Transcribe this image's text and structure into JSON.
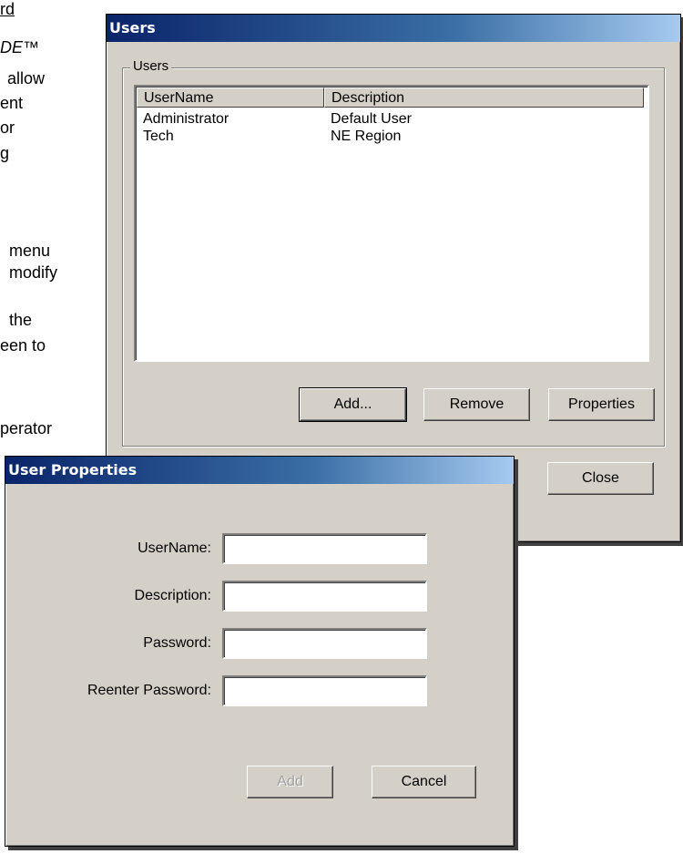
{
  "background_doc": {
    "lines": [
      "rd",
      "DE™",
      "allow",
      "ent",
      "or",
      "g",
      "menu",
      "modify",
      "the",
      "een to",
      "perator"
    ]
  },
  "users_window": {
    "title": "Users",
    "group_label": "Users",
    "columns": [
      "UserName",
      "Description"
    ],
    "rows": [
      {
        "username": "Administrator",
        "description": "Default User"
      },
      {
        "username": "Tech",
        "description": "NE Region"
      }
    ],
    "buttons": {
      "add": "Add...",
      "remove": "Remove",
      "properties": "Properties",
      "close": "Close"
    }
  },
  "user_properties_window": {
    "title": "User Properties",
    "fields": {
      "username": {
        "label": "UserName:",
        "value": ""
      },
      "description": {
        "label": "Description:",
        "value": ""
      },
      "password": {
        "label": "Password:",
        "value": ""
      },
      "reenter_password": {
        "label": "Reenter Password:",
        "value": ""
      }
    },
    "buttons": {
      "add": "Add",
      "cancel": "Cancel"
    },
    "add_enabled": false
  },
  "colors": {
    "titlebar_start": "#0a246a",
    "titlebar_end": "#a6caf0",
    "window_face": "#d4d0c8"
  }
}
